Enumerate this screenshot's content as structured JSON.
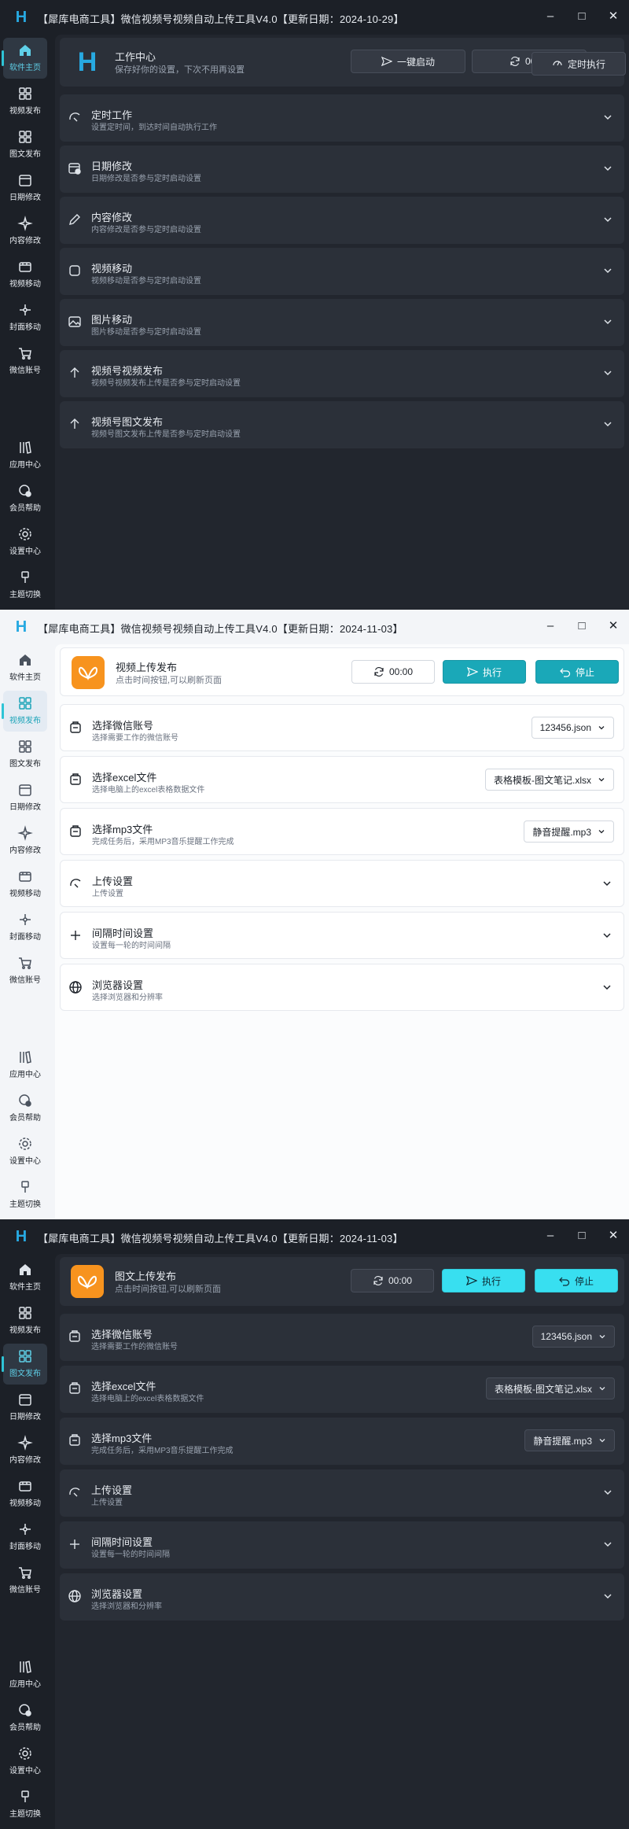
{
  "colors": {
    "accent": "#1aa8b8",
    "accent_bright": "#38dff0",
    "brand_orange": "#f7931e",
    "logo_blue": "#27a9e1"
  },
  "sidebar": {
    "items": [
      {
        "label": "软件主页",
        "icon": "home-icon"
      },
      {
        "label": "视频发布",
        "icon": "video-publish-icon"
      },
      {
        "label": "图文发布",
        "icon": "grid-icon"
      },
      {
        "label": "日期修改",
        "icon": "calendar-icon"
      },
      {
        "label": "内容修改",
        "icon": "sparkle-icon"
      },
      {
        "label": "视频移动",
        "icon": "film-icon"
      },
      {
        "label": "封面移动",
        "icon": "move-icon"
      },
      {
        "label": "微信账号",
        "icon": "cart-icon"
      }
    ],
    "bottom": [
      {
        "label": "应用中心",
        "icon": "books-icon"
      },
      {
        "label": "会员帮助",
        "icon": "member-icon"
      },
      {
        "label": "设置中心",
        "icon": "gear-icon"
      },
      {
        "label": "主题切换",
        "icon": "brush-icon"
      }
    ]
  },
  "windows": [
    {
      "title": "【犀库电商工具】微信视频号视频自动上传工具V4.0【更新日期：2024-10-29】",
      "header": {
        "title": "工作中心",
        "subtitle": "保存好你的设置，下次不用再设置",
        "btn_start": "一键启动",
        "timer": "00:00",
        "btn_schedule": "定时执行"
      },
      "rows": [
        {
          "label": "定时工作",
          "sub": "设置定时间，到达时间自动执行工作",
          "icon": "timer-icon"
        },
        {
          "label": "日期修改",
          "sub": "日期修改是否参与定时启动设置",
          "icon": "calendar-edit-icon"
        },
        {
          "label": "内容修改",
          "sub": "内容修改是否参与定时启动设置",
          "icon": "pen-icon"
        },
        {
          "label": "视频移动",
          "sub": "视频移动是否参与定时启动设置",
          "icon": "frame-icon"
        },
        {
          "label": "图片移动",
          "sub": "图片移动是否参与定时启动设置",
          "icon": "image-icon"
        },
        {
          "label": "视频号视频发布",
          "sub": "视频号视频发布上传是否参与定时启动设置",
          "icon": "arrow-up-icon"
        },
        {
          "label": "视频号图文发布",
          "sub": "视频号图文发布上传是否参与定时启动设置",
          "icon": "arrow-up-icon"
        }
      ]
    },
    {
      "title": "【犀库电商工具】微信视频号视频自动上传工具V4.0【更新日期：2024-11-03】",
      "header": {
        "title": "视频上传发布",
        "subtitle": "点击时间按钮,可以刷新页面",
        "timer": "00:00",
        "btn_run": "执行",
        "btn_stop": "停止"
      },
      "rows": [
        {
          "label": "选择微信账号",
          "sub": "选择需要工作的微信账号",
          "value": "123456.json"
        },
        {
          "label": "选择excel文件",
          "sub": "选择电脑上的excel表格数据文件",
          "value": "表格模板-图文笔记.xlsx"
        },
        {
          "label": "选择mp3文件",
          "sub": "完成任务后，采用MP3音乐提醒工作完成",
          "value": "静音提醒.mp3"
        },
        {
          "label": "上传设置",
          "sub": "上传设置"
        },
        {
          "label": "间隔时间设置",
          "sub": "设置每一轮的时间间隔"
        },
        {
          "label": "浏览器设置",
          "sub": "选择浏览器和分辨率"
        }
      ]
    },
    {
      "title": "【犀库电商工具】微信视频号视频自动上传工具V4.0【更新日期：2024-11-03】",
      "header": {
        "title": "图文上传发布",
        "subtitle": "点击时间按钮,可以刷新页面",
        "timer": "00:00",
        "btn_run": "执行",
        "btn_stop": "停止"
      },
      "rows": [
        {
          "label": "选择微信账号",
          "sub": "选择需要工作的微信账号",
          "value": "123456.json"
        },
        {
          "label": "选择excel文件",
          "sub": "选择电脑上的excel表格数据文件",
          "value": "表格模板-图文笔记.xlsx"
        },
        {
          "label": "选择mp3文件",
          "sub": "完成任务后，采用MP3音乐提醒工作完成",
          "value": "静音提醒.mp3"
        },
        {
          "label": "上传设置",
          "sub": "上传设置"
        },
        {
          "label": "间隔时间设置",
          "sub": "设置每一轮的时间间隔"
        },
        {
          "label": "浏览器设置",
          "sub": "选择浏览器和分辨率"
        }
      ]
    }
  ]
}
